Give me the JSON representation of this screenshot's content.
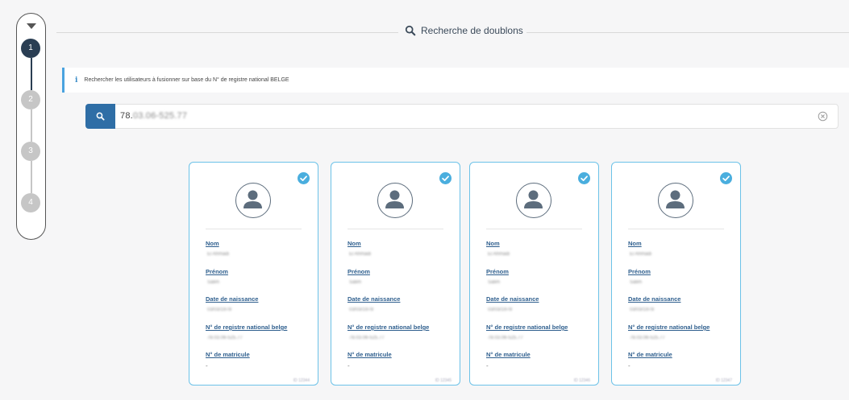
{
  "header": {
    "title": "Recherche de doublons"
  },
  "stepper": {
    "steps": [
      "1",
      "2",
      "3",
      "4"
    ],
    "active_step": 1
  },
  "info": {
    "text": "Rechercher les utilisateurs à fusionner sur base du N° de registre national BELGE"
  },
  "search": {
    "value_prefix": "78.",
    "value_masked": "03.06-525.77"
  },
  "card_labels": {
    "nom": "Nom",
    "prenom": "Prénom",
    "date": "Date de naissance",
    "registre": "N° de registre national belge",
    "matricule": "N° de matricule",
    "matricule_value": "-"
  },
  "cards": [
    {
      "nom": "El Ahmadi",
      "prenom": "Salim",
      "date": "03/03/1978",
      "registre": "78.03.06-525.77",
      "footer": "ID 12344"
    },
    {
      "nom": "El Ahmadi",
      "prenom": "Salim",
      "date": "03/03/1978",
      "registre": "78.03.06-525.77",
      "footer": "ID 12345"
    },
    {
      "nom": "El Ahmadi",
      "prenom": "Salim",
      "date": "03/03/1978",
      "registre": "78.03.06-525.77",
      "footer": "ID 12346"
    },
    {
      "nom": "El Ahmadi",
      "prenom": "Salim",
      "date": "03/03/1978",
      "registre": "78.03.06-525.77",
      "footer": "ID 12347"
    }
  ],
  "colors": {
    "active_step": "#2a3e53",
    "accent": "#2f6ea6",
    "card_border": "#6cc2e8",
    "check": "#4aaede",
    "info_border": "#4aa3df"
  }
}
